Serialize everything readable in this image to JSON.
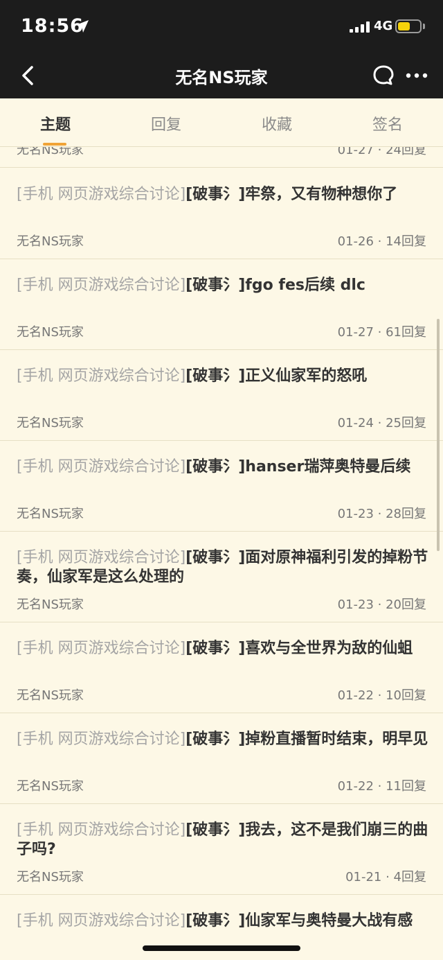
{
  "status_bar": {
    "time": "18:56",
    "carrier": "4G",
    "icons": [
      "location-arrow-icon",
      "signal-icon",
      "battery-icon"
    ]
  },
  "nav": {
    "title": "无名NS玩家",
    "icons": [
      "back-icon",
      "chat-icon",
      "more-icon"
    ]
  },
  "tabs": [
    {
      "label": "主题",
      "active": true
    },
    {
      "label": "回复",
      "active": false
    },
    {
      "label": "收藏",
      "active": false
    },
    {
      "label": "签名",
      "active": false
    }
  ],
  "partial_row": {
    "author": "无名NS玩家",
    "meta": "01-27 · 24回复"
  },
  "posts": [
    {
      "forum": "[手机 网页游戏综合讨论]",
      "crumb": "[破事氵]",
      "title": "牢祭，又有物种想你了",
      "author": "无名NS玩家",
      "meta": "01-26 · 14回复"
    },
    {
      "forum": "[手机 网页游戏综合讨论]",
      "crumb": "[破事氵]",
      "title": "fgo fes后续 dlc",
      "author": "无名NS玩家",
      "meta": "01-27 · 61回复"
    },
    {
      "forum": "[手机 网页游戏综合讨论]",
      "crumb": "[破事氵]",
      "title": "正义仙家军的怒吼",
      "author": "无名NS玩家",
      "meta": "01-24 · 25回复"
    },
    {
      "forum": "[手机 网页游戏综合讨论]",
      "crumb": "[破事氵]",
      "title": "hanser瑞萍奥特曼后续",
      "author": "无名NS玩家",
      "meta": "01-23 · 28回复"
    },
    {
      "forum": "[手机 网页游戏综合讨论]",
      "crumb": "[破事氵]",
      "title": "面对原神福利引发的掉粉节奏，仙家军是这么处理的",
      "author": "无名NS玩家",
      "meta": "01-23 · 20回复"
    },
    {
      "forum": "[手机 网页游戏综合讨论]",
      "crumb": "[破事氵]",
      "title": "喜欢与全世界为敌的仙蛆",
      "author": "无名NS玩家",
      "meta": "01-22 · 10回复"
    },
    {
      "forum": "[手机 网页游戏综合讨论]",
      "crumb": "[破事氵]",
      "title": "掉粉直播暂时结束，明早见",
      "author": "无名NS玩家",
      "meta": "01-22 · 11回复"
    },
    {
      "forum": "[手机 网页游戏综合讨论]",
      "crumb": "[破事氵]",
      "title": "我去，这不是我们崩三的曲子吗?",
      "author": "无名NS玩家",
      "meta": "01-21 · 4回复"
    },
    {
      "forum": "[手机 网页游戏综合讨论]",
      "crumb": "[破事氵]",
      "title": "仙家军与奥特曼大战有感",
      "author": "",
      "meta": ""
    }
  ]
}
